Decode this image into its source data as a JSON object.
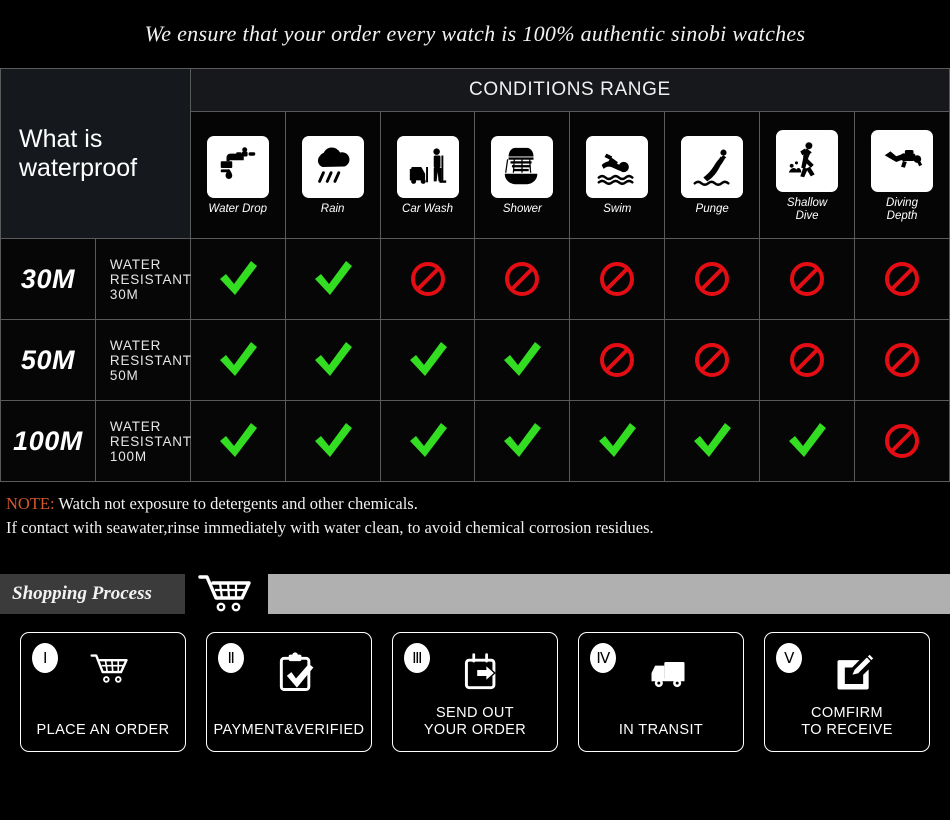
{
  "banner": {
    "text": "We ensure that your order every watch is 100% authentic sinobi watches"
  },
  "table": {
    "title": "What is waterproof",
    "conditions_header": "CONDITIONS RANGE",
    "columns": [
      {
        "label": "Water Drop",
        "icon": "faucet-drop-icon"
      },
      {
        "label": "Rain",
        "icon": "rain-cloud-icon"
      },
      {
        "label": "Car Wash",
        "icon": "car-wash-icon"
      },
      {
        "label": "Shower",
        "icon": "shower-icon"
      },
      {
        "label": "Swim",
        "icon": "swimmer-icon"
      },
      {
        "label": "Punge",
        "icon": "plunge-dive-icon"
      },
      {
        "label": "Shallow\nDive",
        "icon": "shallow-dive-icon"
      },
      {
        "label": "Diving\nDepth",
        "icon": "scuba-diver-icon"
      }
    ],
    "rows": [
      {
        "depth": "30M",
        "description": "WATER RESISTANT  30M",
        "marks": [
          "check",
          "check",
          "ban",
          "ban",
          "ban",
          "ban",
          "ban",
          "ban"
        ]
      },
      {
        "depth": "50M",
        "description": "WATER RESISTANT 50M",
        "marks": [
          "check",
          "check",
          "check",
          "check",
          "ban",
          "ban",
          "ban",
          "ban"
        ]
      },
      {
        "depth": "100M",
        "description": "WATER RESISTANT  100M",
        "marks": [
          "check",
          "check",
          "check",
          "check",
          "check",
          "check",
          "check",
          "ban"
        ]
      }
    ],
    "mark_colors": {
      "check": "#33dd22",
      "ban": "#e50d14"
    }
  },
  "note": {
    "tag": "NOTE:",
    "line1": " Watch not exposure to detergents and other chemicals.",
    "line2": "If contact with seawater,rinse immediately with water clean, to avoid chemical corrosion residues."
  },
  "process": {
    "label": "Shopping Process",
    "cart_icon": "shopping-cart-icon",
    "bar_color": "#b0b0b0",
    "label_bg": "#3b3b3b"
  },
  "steps": [
    {
      "numeral": "Ⅰ",
      "label": "PLACE AN ORDER",
      "icon": "shopping-cart-icon"
    },
    {
      "numeral": "Ⅱ",
      "label": "PAYMENT&VERIFIED",
      "icon": "clipboard-check-icon"
    },
    {
      "numeral": "Ⅲ",
      "label": "SEND OUT\nYOUR ORDER",
      "icon": "calendar-arrow-icon"
    },
    {
      "numeral": "Ⅳ",
      "label": "IN TRANSIT",
      "icon": "delivery-truck-icon"
    },
    {
      "numeral": "Ⅴ",
      "label": "COMFIRM\nTO RECEIVE",
      "icon": "edit-pencil-icon"
    }
  ]
}
